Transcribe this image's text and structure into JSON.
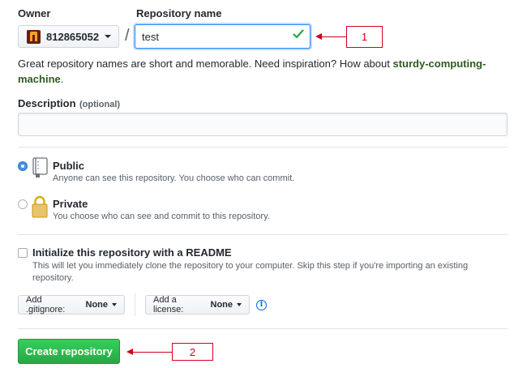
{
  "owner": {
    "label": "Owner",
    "value": "812865052"
  },
  "separator": "/",
  "repo_name": {
    "label": "Repository name",
    "value": "test"
  },
  "hint": {
    "text": "Great repository names are short and memorable. Need inspiration? How about ",
    "suggestion_part1": "sturdy-computing-",
    "suggestion_part2": "machine",
    "end": "."
  },
  "description": {
    "label": "Description",
    "optional": "(optional)",
    "value": ""
  },
  "visibility": {
    "public": {
      "title": "Public",
      "desc": "Anyone can see this repository. You choose who can commit."
    },
    "private": {
      "title": "Private",
      "desc": "You choose who can see and commit to this repository."
    }
  },
  "readme": {
    "title": "Initialize this repository with a README",
    "desc_line1": "This will let you immediately clone the repository to your computer. Skip this step if you're importing an existing",
    "desc_line2": "repository."
  },
  "gitignore": {
    "label": "Add .gitignore:",
    "value": "None"
  },
  "license": {
    "label": "Add a license:",
    "value": "None"
  },
  "info_icon": "i",
  "create_button": "Create repository",
  "annotations": {
    "one": "1",
    "two": "2"
  },
  "colors": {
    "accent": "#2188ff",
    "success": "#28a745",
    "annotation": "#d0021b",
    "link_green": "#2c5c1c"
  }
}
